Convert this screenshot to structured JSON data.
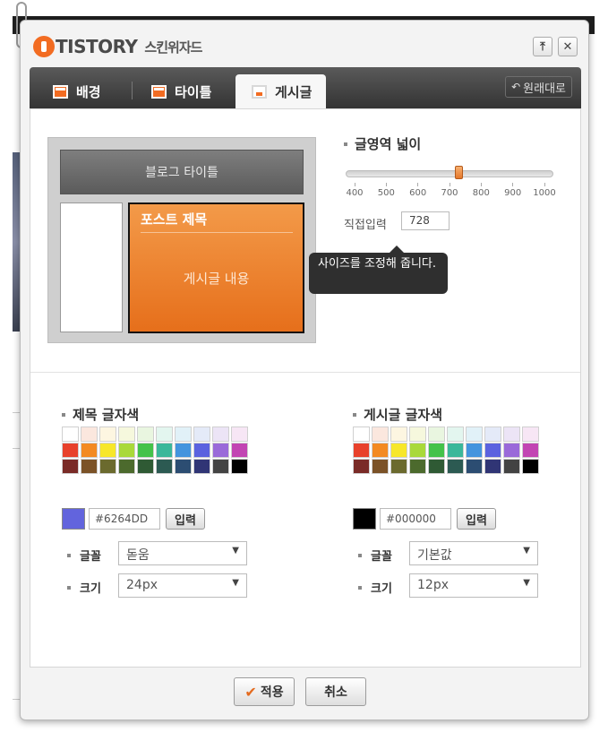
{
  "dialog": {
    "logo_text": "TISTORY",
    "title": "스킨위자드",
    "pin_icon": "pin-top-icon",
    "close_icon": "close-icon"
  },
  "tabs": [
    {
      "label": "배경",
      "icon": "layout-icon"
    },
    {
      "label": "타이틀",
      "icon": "title-layout-icon"
    },
    {
      "label": "게시글",
      "icon": "post-layout-icon",
      "active": true
    }
  ],
  "reset_label": "원래대로",
  "preview": {
    "blog_title": "블로그 타이틀",
    "post_title": "포스트 제목",
    "post_body": "게시글 내용"
  },
  "width": {
    "title": "글영역 넓이",
    "ticks": [
      "400",
      "500",
      "600",
      "700",
      "800",
      "900",
      "1000"
    ],
    "min": 400,
    "max": 1000,
    "value": 728,
    "direct_label": "직접입력",
    "direct_value": "728",
    "tooltip": "사이즈를 조정해 줍니다."
  },
  "palette_colors": [
    "#ffffff",
    "#fbe7de",
    "#fdf6e1",
    "#f6f8dd",
    "#e9f6e0",
    "#e3f6ef",
    "#e1f1f8",
    "#e4eaf8",
    "#ece4f6",
    "#f7e6f5",
    "#e8412b",
    "#f38a22",
    "#f7e72a",
    "#a9d93a",
    "#44c24a",
    "#3bb79a",
    "#4494de",
    "#5b62df",
    "#9a6ad9",
    "#c245b3",
    "#7a2b27",
    "#7b5227",
    "#6b6a2e",
    "#4c6a2d",
    "#2f5a34",
    "#2c5a52",
    "#2c4d72",
    "#303575",
    "#434343",
    "#000000"
  ],
  "title_color": {
    "label": "제목 글자색",
    "value": "#6264DD",
    "swatch": "#6264dd",
    "apply": "입력",
    "font_label": "글꼴",
    "font_value": "돋움",
    "size_label": "크기",
    "size_value": "24px"
  },
  "post_color": {
    "label": "게시글 글자색",
    "value": "#000000",
    "swatch": "#000000",
    "apply": "입력",
    "font_label": "글꼴",
    "font_value": "기본값",
    "size_label": "크기",
    "size_value": "12px"
  },
  "footer": {
    "apply": "적용",
    "cancel": "취소"
  },
  "colors": {
    "accent": "#f26c22",
    "tabbar": "#3d3d3d"
  }
}
